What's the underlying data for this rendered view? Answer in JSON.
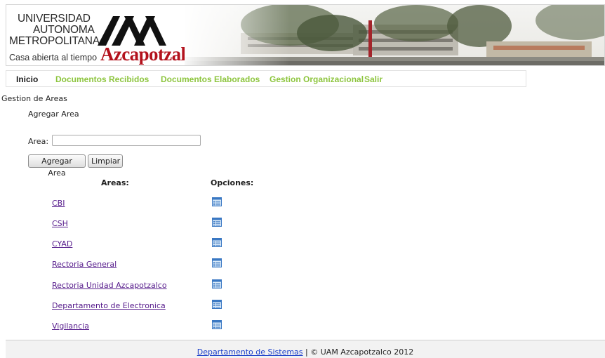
{
  "header": {
    "university_lines": [
      "UNIVERSIDAD",
      "AUTONOMA",
      "METROPOLITANA"
    ],
    "tagline": "Casa abierta al tiempo",
    "campus": "Azcapotzalco"
  },
  "nav": {
    "items": [
      {
        "label": "Inicio",
        "active": true
      },
      {
        "label": "Documentos Recibidos"
      },
      {
        "label": "Documentos Elaborados"
      },
      {
        "label": "Gestion Organizacional"
      },
      {
        "label": "Salir"
      }
    ]
  },
  "page": {
    "section_title": "Gestion de Areas",
    "sub_title": "Agregar Area",
    "area_label": "Area:",
    "area_value": "",
    "add_button": "Agregar Area",
    "clear_button": "Limpiar"
  },
  "table": {
    "headers": {
      "areas": "Areas:",
      "options": "Opciones:"
    },
    "rows": [
      {
        "area": "CBI"
      },
      {
        "area": "CSH"
      },
      {
        "area": "CYAD"
      },
      {
        "area": "Rectoria General"
      },
      {
        "area": "Rectoria Unidad Azcapotzalco"
      },
      {
        "area": "Departamento de Electronica"
      },
      {
        "area": "Vigilancia"
      }
    ],
    "option_icon": "list-details-icon"
  },
  "footer": {
    "link": "Departamento de Sistemas",
    "text": " | © UAM Azcapotzalco 2012"
  },
  "colors": {
    "nav_link": "#8dc53e",
    "brand_red": "#b3121d",
    "visited_link": "#551a8b",
    "footer_link": "#1a3ec9"
  }
}
